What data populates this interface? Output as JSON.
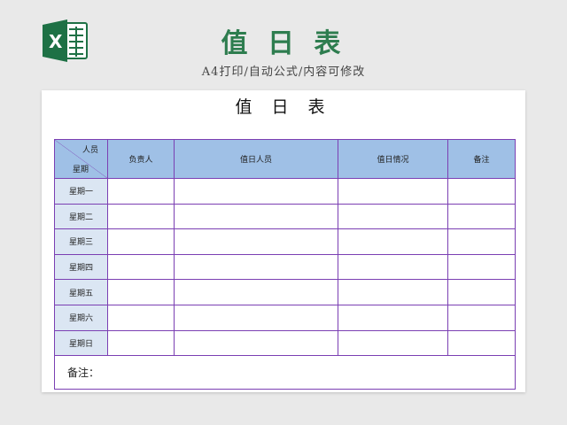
{
  "header": {
    "title": "值 日 表",
    "subtitle": "A4打印/自动公式/内容可修改",
    "logo_icon": "excel-logo-icon",
    "logo_letter": "X",
    "brand_color": "#2e7d4f"
  },
  "sheet": {
    "title": "值 日 表",
    "corner_top": "人员",
    "corner_bottom": "星期",
    "columns": [
      "负责人",
      "值日人员",
      "值日情况",
      "备注"
    ],
    "rows": [
      "星期一",
      "星期二",
      "星期三",
      "星期四",
      "星期五",
      "星期六",
      "星期日"
    ],
    "notes_label": "备注：",
    "border_color": "#7b3fb3",
    "header_color": "#9fc0e6",
    "day_cell_color": "#dbe6f3"
  }
}
